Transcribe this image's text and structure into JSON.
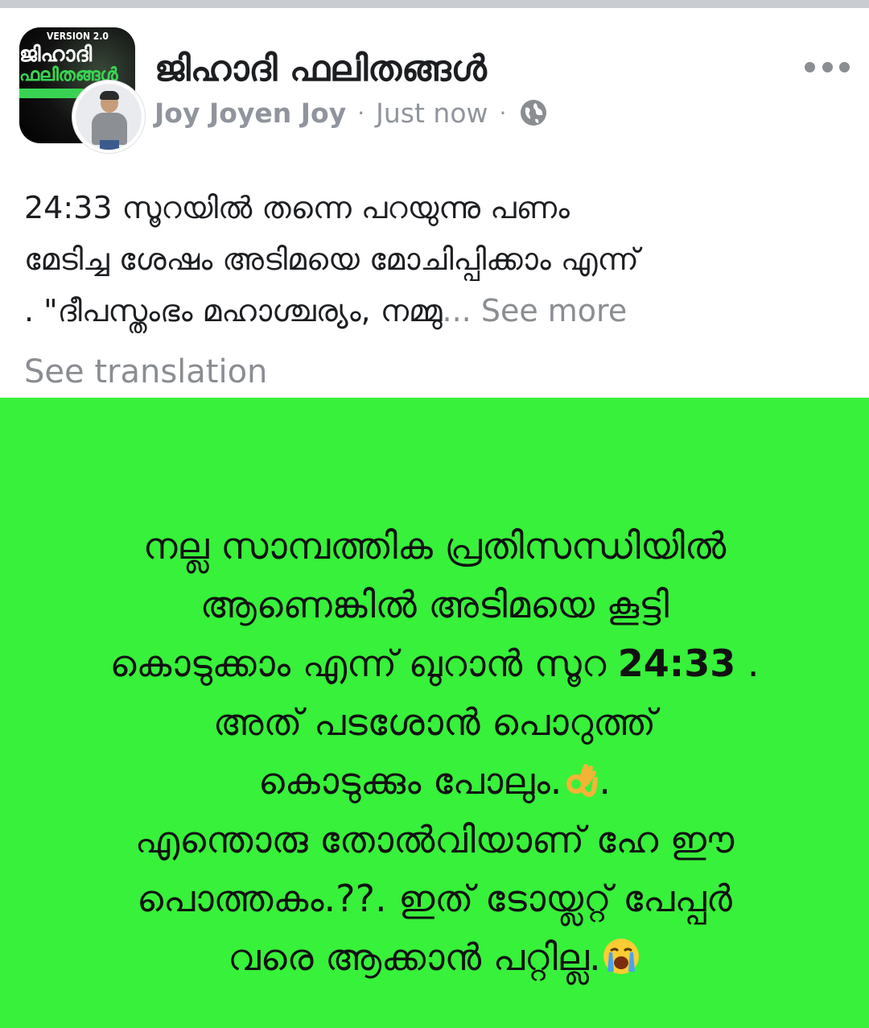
{
  "group": {
    "name": "ജിഹാദി ഫലിതങ്ങൾ",
    "avatar_version_text": "VERSION 2.0",
    "avatar_line1": "ജിഹാദി",
    "avatar_line2": "ഫലിതങ്ങൾ"
  },
  "post": {
    "author": "Joy Joyen Joy",
    "separator": "·",
    "timestamp": "Just now",
    "privacy_icon": "globe-icon",
    "text_lines": [
      "24:33 സൂറയിൽ തന്നെ പറയുന്നു പണം",
      "മേടിച്ച ശേഷം അടിമയെ മോചിപ്പിക്കാം എന്ന്",
      ". \"ദീപസ്തംഭം മഹാശ്ചര്യം, നമ്മു"
    ],
    "ellipsis_see_more": "... See more",
    "see_translation": "See translation"
  },
  "image_card": {
    "background_color": "#37f13a",
    "lines": [
      "നല്ല സാമ്പത്തിക പ്രതിസന്ധിയിൽ",
      "ആണെങ്കിൽ അടിമയെ കൂട്ടി",
      "കൊടുക്കാം എന്ന് ഖുറാൻ സൂറ",
      "അത് പടശോൻ പൊറുത്ത്",
      "കൊടുക്കും പോലും.",
      "എന്തൊരു തോൽവിയാണ് ഹേ ഈ",
      "പൊത്തകം.??. ഇത് ടോയ്ലറ്റ് പേപ്പർ",
      "വരെ ആക്കാൻ പറ്റില്ല."
    ],
    "sura_number": "24:33",
    "line3_suffix": " .",
    "line5_suffix": ".",
    "emoji_ok": "ok-hand-emoji",
    "emoji_cry": "crying-face-emoji"
  }
}
